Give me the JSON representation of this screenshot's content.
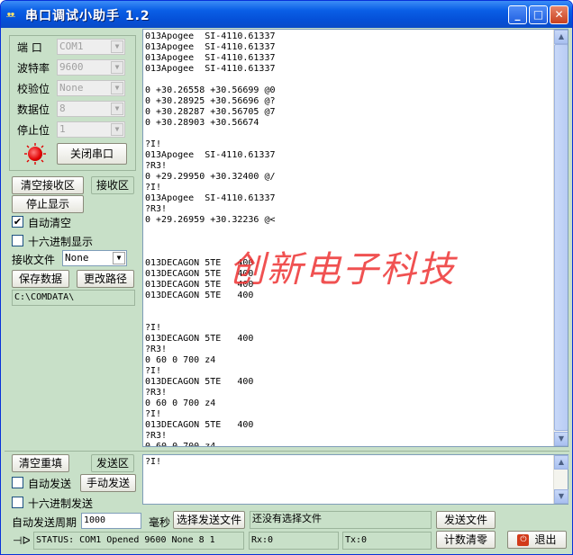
{
  "window": {
    "title": "串口调试小助手  1.2",
    "app_icon": "app-logo-icon",
    "buttons": {
      "minimize": "_",
      "maximize": "□",
      "close": "✕"
    }
  },
  "settings": {
    "port_label": "端  口",
    "port_value": "COM1",
    "baud_label": "波特率",
    "baud_value": "9600",
    "parity_label": "校验位",
    "parity_value": "None",
    "databits_label": "数据位",
    "databits_value": "8",
    "stopbits_label": "停止位",
    "stopbits_value": "1",
    "close_port_button": "关闭串口"
  },
  "receive_controls": {
    "clear_receive_button": "清空接收区",
    "receive_area_label": "接收区",
    "stop_display_button": "停止显示",
    "auto_clear_label": "自动清空",
    "auto_clear_checked": true,
    "hex_display_label": "十六进制显示",
    "hex_display_checked": false,
    "receive_file_label": "接收文件",
    "receive_file_value": "None",
    "save_data_button": "保存数据",
    "change_path_button": "更改路径",
    "path_value": "C:\\COMDATA\\"
  },
  "receive_area": {
    "content": "013Apogee  SI-4110.61337\n013Apogee  SI-4110.61337\n013Apogee  SI-4110.61337\n013Apogee  SI-4110.61337\n\n0 +30.26558 +30.56699 @0\n0 +30.28925 +30.56696 @?\n0 +30.28287 +30.56705 @7\n0 +30.28903 +30.56674\n\n?I!\n013Apogee  SI-4110.61337\n?R3!\n0 +29.29950 +30.32400 @/\n?I!\n013Apogee  SI-4110.61337\n?R3!\n0 +29.26959 +30.32236 @<\n\n\n\n013DECAGON 5TE   400\n013DECAGON 5TE   400\n013DECAGON 5TE   400\n013DECAGON 5TE   400\n\n\n?I!\n013DECAGON 5TE   400\n?R3!\n0 60 0 700 z4\n?I!\n013DECAGON 5TE   400\n?R3!\n0 60 0 700 z4\n?I!\n013DECAGON 5TE   400\n?R3!\n0 60 0 700 z4",
    "watermark": "创新电子科技"
  },
  "send_controls": {
    "clear_resend_button": "清空重填",
    "send_area_label": "发送区",
    "auto_send_label": "自动发送",
    "auto_send_checked": false,
    "manual_send_button": "手动发送",
    "hex_send_label": "十六进制发送",
    "hex_send_checked": false,
    "auto_send_period_label": "自动发送周期",
    "auto_send_period_value": "1000",
    "ms_label": "毫秒",
    "select_send_file_button": "选择发送文件",
    "no_file_selected_text": "还没有选择文件",
    "send_file_button": "发送文件",
    "reset_count_button": "计数清零",
    "exit_button": "退出",
    "send_content": "?I!"
  },
  "status_bar": {
    "status_text": "STATUS: COM1 Opened 9600 None 8 1",
    "rx_text": "Rx:0",
    "tx_text": "Tx:0",
    "pin_icon": "pin-icon"
  },
  "colors": {
    "window_bg": "#c8e0c8",
    "titlebar": "#0550d8",
    "watermark": "#e33333",
    "led": "#e00000"
  }
}
